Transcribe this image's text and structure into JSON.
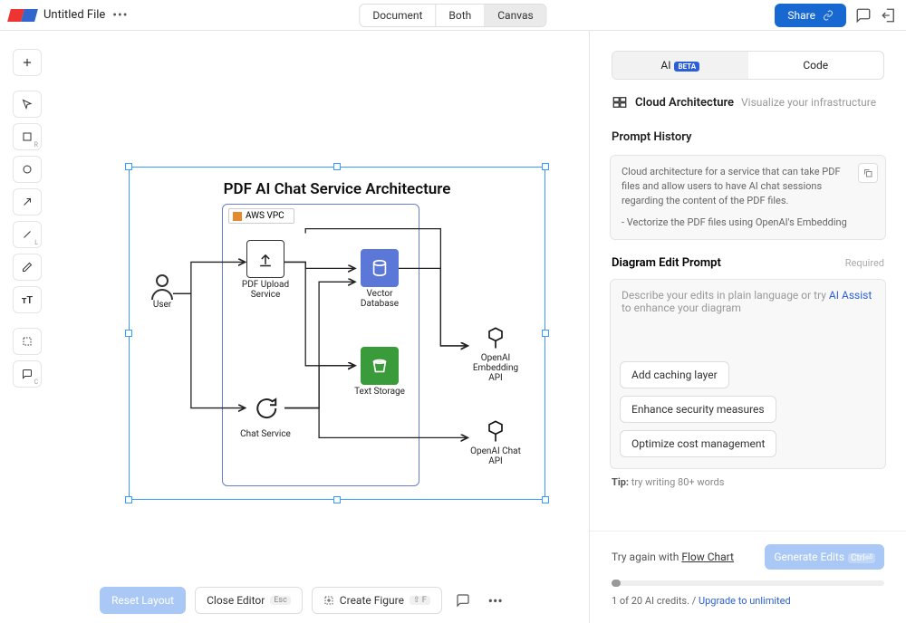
{
  "header": {
    "filename": "Untitled File",
    "view_tabs": [
      "Document",
      "Both",
      "Canvas"
    ],
    "active_view": "Canvas",
    "share_label": "Share"
  },
  "toolbar_icons": [
    "plus",
    "pointer",
    "square",
    "circle",
    "arrow-up-right",
    "line",
    "pencil",
    "text",
    "crop",
    "comment"
  ],
  "diagram": {
    "title": "PDF AI Chat Service Architecture",
    "vpc_label": "AWS VPC",
    "nodes": {
      "user": "User",
      "upload": "PDF Upload Service",
      "chat": "Chat Service",
      "vector": "Vector Database",
      "text": "Text Storage",
      "embed": "OpenAI Embedding API",
      "chatapi": "OpenAI Chat API"
    }
  },
  "panel": {
    "tabs": {
      "ai": "AI",
      "beta": "BETA",
      "code": "Code"
    },
    "head_label": "Cloud Architecture",
    "head_hint": "Visualize your infrastructure",
    "history_title": "Prompt History",
    "history_body": "Cloud architecture for a service that can take PDF files and allow users to have AI chat sessions regarding the content of the PDF files.",
    "history_body2": "- Vectorize the PDF files using OpenAI's Embedding",
    "edit_title": "Diagram Edit Prompt",
    "edit_required": "Required",
    "edit_placeholder1": "Describe your edits in plain language or try",
    "edit_ai_assist": "AI Assist",
    "edit_placeholder2": "to enhance your diagram",
    "suggestions": [
      "Add caching layer",
      "Enhance security measures",
      "Optimize cost management"
    ],
    "tip_label": "Tip:",
    "tip_text": "try writing 80+ words",
    "try_again_prefix": "Try again with",
    "try_again_link": "Flow Chart",
    "generate_label": "Generate Edits",
    "generate_kbd": "Ctrl⏎",
    "credits_text": "1 of 20 AI credits.",
    "credits_link": "Upgrade to unlimited"
  },
  "bottombar": {
    "reset": "Reset Layout",
    "close": "Close Editor",
    "close_kbd": "Esc",
    "create": "Create Figure",
    "create_kbd": "⇧ F"
  }
}
